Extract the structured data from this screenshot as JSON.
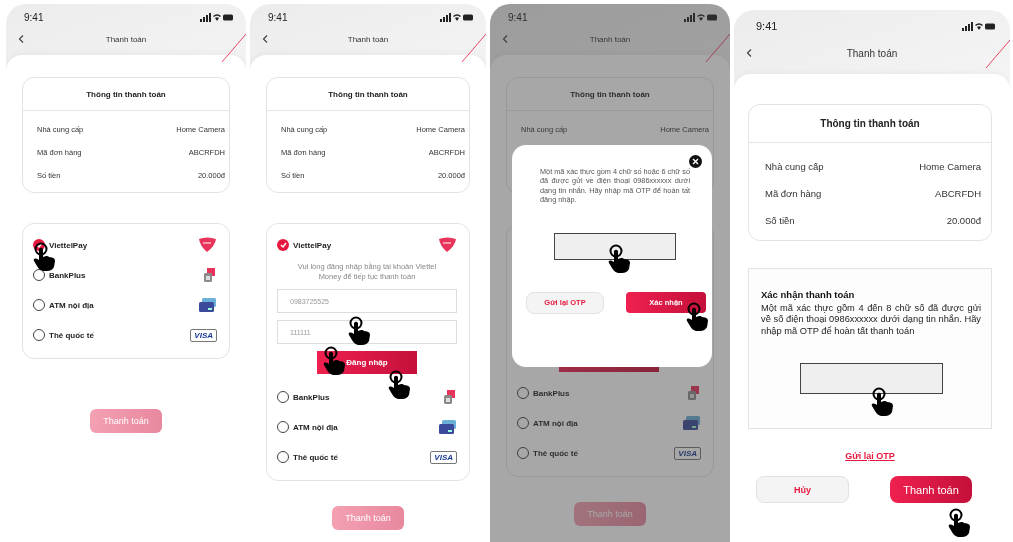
{
  "screens": [
    {
      "kind": "select",
      "time": "9:41",
      "title": "Thanh toán",
      "info": {
        "title": "Thông tin thanh toán",
        "rows": [
          {
            "label": "Nhà cung cấp",
            "value": "Home Camera"
          },
          {
            "label": "Mã đơn hàng",
            "value": "ABCRFDH"
          },
          {
            "label": "Số tiền",
            "value": "20.000đ"
          }
        ]
      },
      "methods": [
        {
          "kind": "wallet",
          "label": "ViettelPay",
          "selected": true
        },
        {
          "kind": "bank",
          "label": "BankPlus",
          "selected": false
        },
        {
          "kind": "atm",
          "label": "ATM nội địa",
          "selected": false
        },
        {
          "kind": "card",
          "label": "Thẻ quốc tế",
          "selected": false,
          "badge": "VISA"
        }
      ],
      "pay_button": {
        "label": "Thanh toán",
        "disabled": true
      }
    },
    {
      "kind": "login",
      "time": "9:41",
      "title": "Thanh toán",
      "info": {
        "title": "Thông tin thanh toán",
        "rows": [
          {
            "label": "Nhà cung cấp",
            "value": "Home Camera"
          },
          {
            "label": "Mã đơn hàng",
            "value": "ABCRFDH"
          },
          {
            "label": "Số tiền",
            "value": "20.000đ"
          }
        ]
      },
      "methods": [
        {
          "kind": "wallet",
          "label": "ViettelPay",
          "selected": true,
          "login": {
            "hint": "Vui lòng đăng nhập bằng tài khoản Viettel Money để tiếp tục thanh toán",
            "phone": "0983725525",
            "password": "111111",
            "button": "Đăng nhập"
          }
        },
        {
          "kind": "bank",
          "label": "BankPlus",
          "selected": false
        },
        {
          "kind": "atm",
          "label": "ATM nội địa",
          "selected": false
        },
        {
          "kind": "card",
          "label": "Thẻ quốc tế",
          "selected": false,
          "badge": "VISA"
        }
      ],
      "pay_button": {
        "label": "Thanh toán",
        "disabled": true
      }
    },
    {
      "kind": "otp_modal",
      "time": "9:41",
      "title": "Thanh toán",
      "info": {
        "title": "Thông tin thanh toán",
        "rows": [
          {
            "label": "Nhà cung cấp",
            "value": "Home Camera"
          }
        ]
      },
      "methods": [
        {
          "kind": "bank",
          "label": "BankPlus",
          "selected": false
        },
        {
          "kind": "atm",
          "label": "ATM nội địa",
          "selected": false
        },
        {
          "kind": "card",
          "label": "Thẻ quốc tế",
          "selected": false,
          "badge": "VISA"
        }
      ],
      "pay_button": {
        "label": "Thanh toán",
        "disabled": true
      },
      "modal": {
        "message": "Một mã xác thực gồm 4 chữ số hoặc 6 chữ số đã được gửi về điện thoại 0986xxxxxx dưới dạng tin nhắn. Hãy nhập mã OTP để hoàn tất đăng nhập.",
        "resend": "Gửi lại OTP",
        "confirm": "Xác nhận"
      }
    },
    {
      "kind": "confirm",
      "time": "9:41",
      "title": "Thanh toán",
      "info": {
        "title": "Thông tin thanh toán",
        "rows": [
          {
            "label": "Nhà cung cấp",
            "value": "Home Camera"
          },
          {
            "label": "Mã đơn hàng",
            "value": "ABCRFDH"
          },
          {
            "label": "Số tiền",
            "value": "20.000đ"
          }
        ]
      },
      "confirm": {
        "title": "Xác nhận thanh toán",
        "message": "Một mã xác thực gồm 4 đến 8 chữ số đã được gửi về số điện thoại 0986xxxxxx dưới dạng tin nhắn. Hãy nhập mã OTP để hoàn tất thanh toán",
        "resend": "Gửi lại OTP",
        "cancel": "Hủy",
        "submit": "Thanh toán"
      }
    }
  ]
}
